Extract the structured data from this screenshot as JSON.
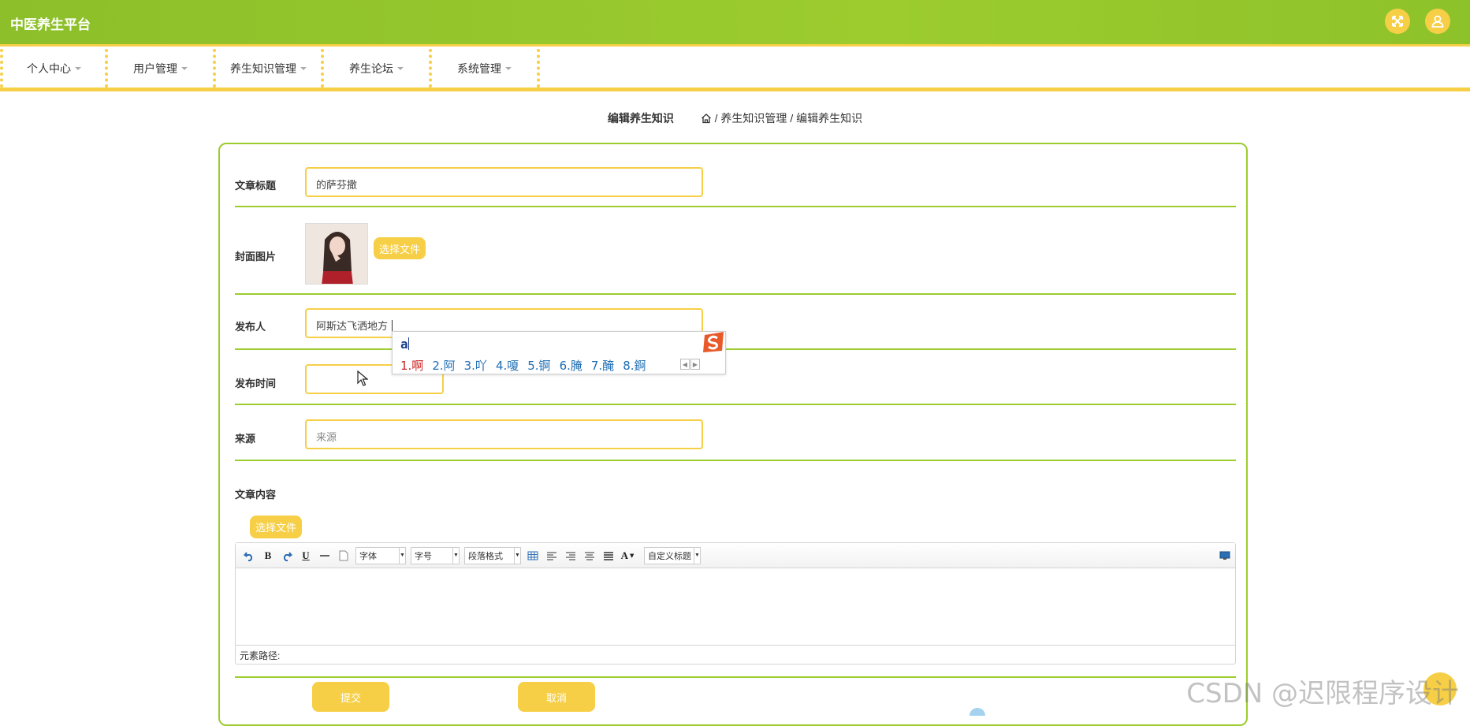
{
  "app": {
    "title": "中医养生平台"
  },
  "header_icons": [
    "fullscreen-icon",
    "user-icon"
  ],
  "nav": [
    {
      "label": "个人中心"
    },
    {
      "label": "用户管理"
    },
    {
      "label": "养生知识管理"
    },
    {
      "label": "养生论坛"
    },
    {
      "label": "系统管理"
    }
  ],
  "breadcrumb": {
    "page_title": "编辑养生知识",
    "path": "/ 养生知识管理 / 编辑养生知识"
  },
  "form": {
    "title_label": "文章标题",
    "title_value": "的萨芬撒",
    "cover_label": "封面图片",
    "choose_file": "选择文件",
    "publisher_label": "发布人",
    "publisher_value": "阿斯达飞洒地方",
    "time_label": "发布时间",
    "time_value": "",
    "source_label": "来源",
    "source_placeholder": "来源",
    "content_label": "文章内容",
    "content_choose_file": "选择文件",
    "submit": "提交",
    "cancel": "取消"
  },
  "editor": {
    "font_select": "字体",
    "size_select": "字号",
    "paragraph_select": "段落格式",
    "custom_title_select": "自定义标题",
    "bold": "B",
    "underline": "U",
    "font_color": "A",
    "path_label": "元素路径:"
  },
  "ime": {
    "composition": "a",
    "candidates": [
      "1.啊",
      "2.阿",
      "3.吖",
      "4.嗄",
      "5.锕",
      "6.腌",
      "7.醃",
      "8.錒"
    ]
  },
  "watermark": "CSDN @迟限程序设计",
  "colors": {
    "green": "#9ccc2e",
    "yellow": "#f6cf47"
  }
}
